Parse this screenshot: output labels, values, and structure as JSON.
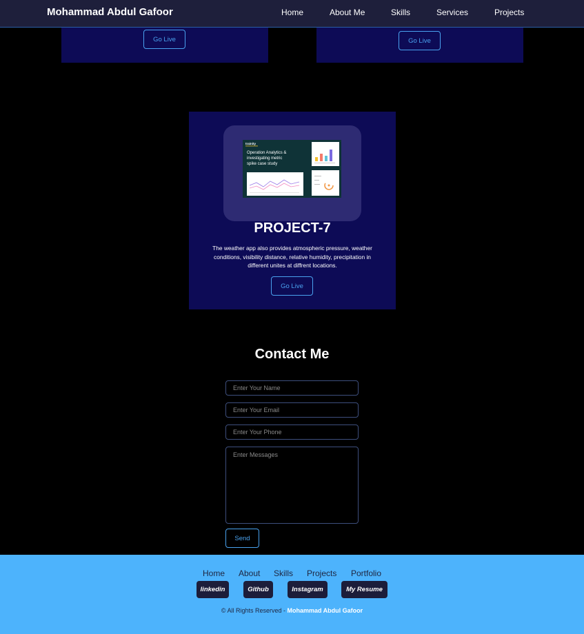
{
  "header": {
    "brand": "Mohammad Abdul Gafoor",
    "nav": [
      "Home",
      "About Me",
      "Skills",
      "Services",
      "Projects"
    ]
  },
  "projects": {
    "previous_cards": [
      {
        "button_label": "Go Live"
      },
      {
        "button_label": "Go Live"
      }
    ],
    "featured": {
      "thumbnail": {
        "brand": "trainity",
        "title_lines": [
          "Operation Analytics &",
          "investigating metric",
          "spike case study"
        ]
      },
      "title": "PROJECT-7",
      "description": "The weather app also provides atmospheric pressure, weather conditions, visibility distance, relative humidity, precipitation in different unites at diffrent locations.",
      "button_label": "Go Live"
    }
  },
  "contact": {
    "title": "Contact Me",
    "name_placeholder": "Enter Your Name",
    "email_placeholder": "Enter Your Email",
    "phone_placeholder": "Enter Your Phone",
    "message_placeholder": "Enter Messages",
    "send_label": "Send"
  },
  "footer": {
    "links": [
      "Home",
      "About",
      "Skills",
      "Projects",
      "Portfolio"
    ],
    "social": [
      "linkedin",
      "Github",
      "Instagram",
      "My Resume"
    ],
    "copyright_prefix": "© All Rights Reserved - ",
    "copyright_owner": "Mohammad Abdul Gafoor"
  },
  "colors": {
    "background": "#000000",
    "navbar": "#1e1f3b",
    "card": "#0d0b56",
    "accent": "#4aa3f0",
    "footer": "#4db3fc",
    "social_button": "#1c1d3a"
  }
}
